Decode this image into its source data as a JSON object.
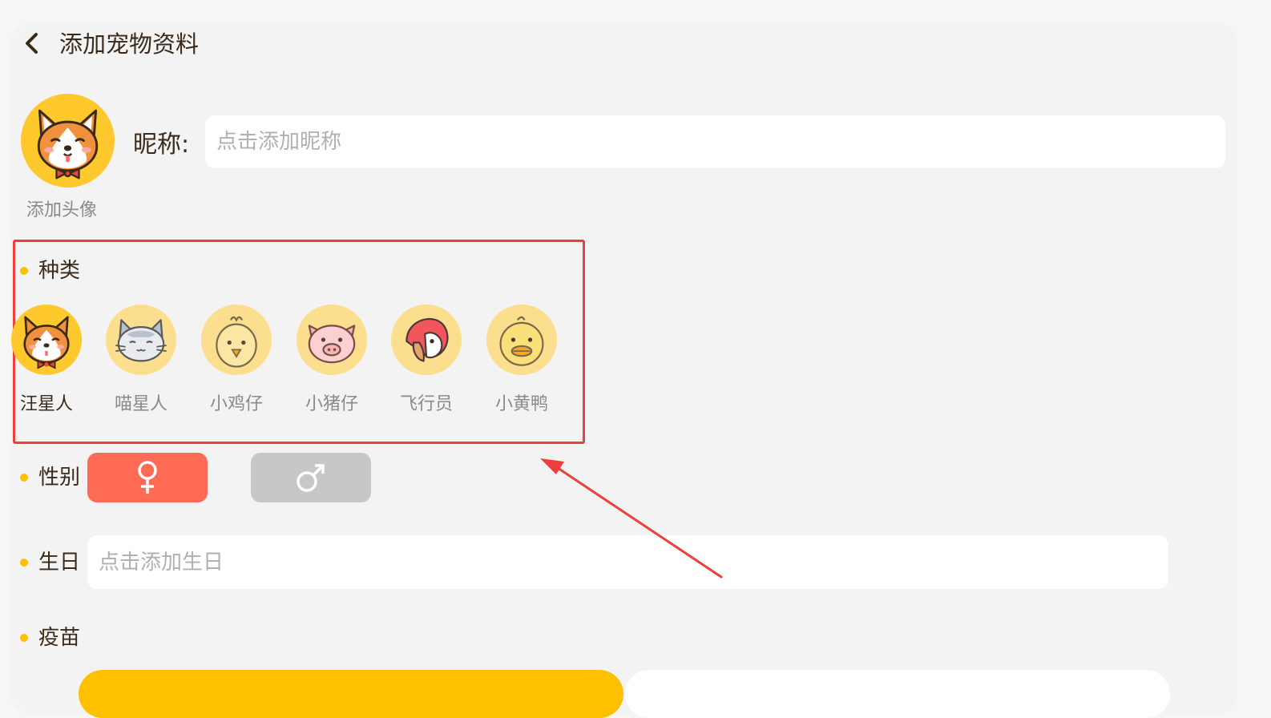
{
  "header": {
    "title": "添加宠物资料"
  },
  "avatar": {
    "caption": "添加头像"
  },
  "nickname": {
    "label": "昵称:",
    "placeholder": "点击添加昵称",
    "value": ""
  },
  "species": {
    "label": "种类",
    "items": [
      {
        "label": "汪星人",
        "icon": "corgi-icon",
        "selected": true
      },
      {
        "label": "喵星人",
        "icon": "cat-icon",
        "selected": false
      },
      {
        "label": "小鸡仔",
        "icon": "chick-icon",
        "selected": false
      },
      {
        "label": "小猪仔",
        "icon": "pig-icon",
        "selected": false
      },
      {
        "label": "飞行员",
        "icon": "parrot-icon",
        "selected": false
      },
      {
        "label": "小黄鸭",
        "icon": "duck-icon",
        "selected": false
      }
    ]
  },
  "gender": {
    "label": "性别",
    "female_symbol": "♀",
    "male_symbol": "♂",
    "selected": "female"
  },
  "birthday": {
    "label": "生日",
    "placeholder": "点击添加生日",
    "value": ""
  },
  "vaccine": {
    "label": "疫苗"
  },
  "colors": {
    "accent": "#ffc000",
    "female": "#ff6b55",
    "male_inactive": "#c7c7c7",
    "annotation": "#ee3e3e",
    "icon_bg": "#fcdf8e",
    "selected_icon_bg": "#ffc82d"
  }
}
